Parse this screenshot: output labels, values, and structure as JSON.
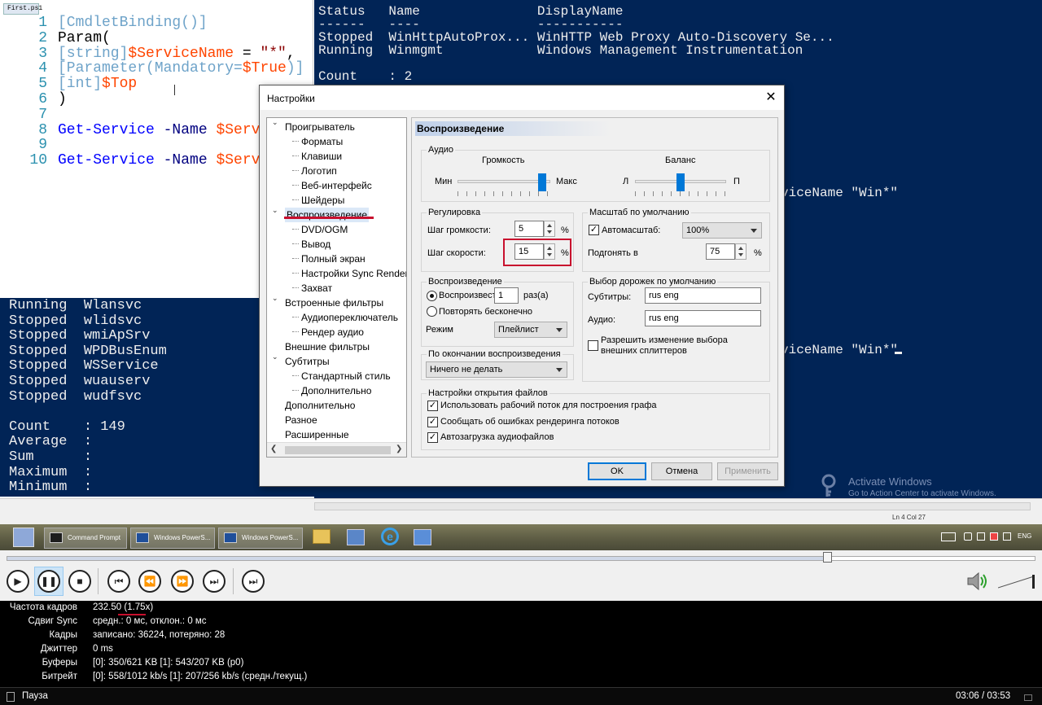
{
  "ise": {
    "tab": "First.ps1",
    "lines": [
      {
        "n": "1",
        "parts": [
          {
            "t": "[CmdletBinding()]",
            "c": "c-br"
          }
        ]
      },
      {
        "n": "2",
        "parts": [
          {
            "t": "Param(",
            "c": "c-plain"
          }
        ]
      },
      {
        "n": "3",
        "parts": [
          {
            "t": "[string]",
            "c": "c-br"
          },
          {
            "t": "$ServiceName",
            "c": "c-var"
          },
          {
            "t": " = ",
            "c": "c-plain"
          },
          {
            "t": "\"*\"",
            "c": "c-str"
          },
          {
            "t": ",",
            "c": "c-plain"
          }
        ]
      },
      {
        "n": "4",
        "parts": [
          {
            "t": "[Parameter(Mandatory=",
            "c": "c-br"
          },
          {
            "t": "$True",
            "c": "c-var"
          },
          {
            "t": ")]",
            "c": "c-br"
          }
        ]
      },
      {
        "n": "5",
        "parts": [
          {
            "t": "[int]",
            "c": "c-br"
          },
          {
            "t": "$Top",
            "c": "c-var"
          }
        ]
      },
      {
        "n": "6",
        "parts": [
          {
            "t": ")",
            "c": "c-plain"
          }
        ]
      },
      {
        "n": "7",
        "parts": []
      },
      {
        "n": "8",
        "parts": [
          {
            "t": "Get-Service",
            "c": "c-cmd"
          },
          {
            "t": " -Name ",
            "c": "c-par"
          },
          {
            "t": "$Serv",
            "c": "c-var"
          }
        ]
      },
      {
        "n": "9",
        "parts": []
      },
      {
        "n": "10",
        "parts": [
          {
            "t": "Get-Service",
            "c": "c-cmd"
          },
          {
            "t": " -Name ",
            "c": "c-par"
          },
          {
            "t": "$Serv",
            "c": "c-var"
          }
        ]
      }
    ]
  },
  "console_top": {
    "lines": [
      "Status   Name               DisplayName",
      "------   ----               -----------",
      "Stopped  WinHttpAutoProx... WinHTTP Web Proxy Auto-Discovery Se...",
      "Running  Winmgmt            Windows Management Instrumentation",
      "",
      "Count    : 2"
    ],
    "frag1": "viceName \"Win*\"",
    "frag2": "viceName \"Win*\""
  },
  "console_bottom": {
    "lines": [
      "Running  Wlansvc",
      "Stopped  wlidsvc",
      "Stopped  wmiApSrv",
      "Stopped  WPDBusEnum",
      "Stopped  WSService",
      "Stopped  wuauserv",
      "Stopped  wudfsvc",
      "",
      "Count    : 149",
      "Average  :",
      "Sum      :",
      "Maximum  :",
      "Minimum  :"
    ]
  },
  "ise_status": {
    "lncol": "Ln 4  Col 27"
  },
  "taskbar": {
    "items": [
      "Command Prompt",
      "Windows PowerS...",
      "Windows PowerS..."
    ],
    "lang": "ENG"
  },
  "activate": {
    "title": "Activate Windows",
    "sub": "Go to Action Center to activate Windows."
  },
  "dialog": {
    "title": "Настройки",
    "close": "✕",
    "tree": [
      {
        "label": "Проигрыватель",
        "level": 0,
        "toggle": "⌄"
      },
      {
        "label": "Форматы",
        "level": 1
      },
      {
        "label": "Клавиши",
        "level": 1
      },
      {
        "label": "Логотип",
        "level": 1
      },
      {
        "label": "Веб-интерфейс",
        "level": 1
      },
      {
        "label": "Шейдеры",
        "level": 1
      },
      {
        "label": "Воспроизведение",
        "level": 0,
        "toggle": "⌄",
        "selected": true
      },
      {
        "label": "DVD/OGM",
        "level": 1
      },
      {
        "label": "Вывод",
        "level": 1
      },
      {
        "label": "Полный экран",
        "level": 1
      },
      {
        "label": "Настройки Sync Render",
        "level": 1
      },
      {
        "label": "Захват",
        "level": 1
      },
      {
        "label": "Встроенные фильтры",
        "level": 0,
        "toggle": "⌄"
      },
      {
        "label": "Аудиопереключатель",
        "level": 1
      },
      {
        "label": "Рендер аудио",
        "level": 1
      },
      {
        "label": "Внешние фильтры",
        "level": 0
      },
      {
        "label": "Субтитры",
        "level": 0,
        "toggle": "⌄"
      },
      {
        "label": "Стандартный стиль",
        "level": 1
      },
      {
        "label": "Дополнительно",
        "level": 1
      },
      {
        "label": "Дополнительно",
        "level": 0
      },
      {
        "label": "Разное",
        "level": 0
      },
      {
        "label": "Расширенные",
        "level": 0
      }
    ],
    "panel": {
      "heading": "Воспроизведение",
      "audio": {
        "legend": "Аудио",
        "volume_label": "Громкость",
        "vol_min": "Мин",
        "vol_max": "Макс",
        "volume_level": 0.95,
        "balance_label": "Баланс",
        "bal_left": "Л",
        "bal_right": "П",
        "balance_level": 0.5
      },
      "regulation": {
        "legend": "Регулировка",
        "vol_step_label": "Шаг громкости:",
        "vol_step": "5",
        "pct1": "%",
        "speed_step_label": "Шаг скорости:",
        "speed_step": "15",
        "pct2": "%"
      },
      "scale": {
        "legend": "Масштаб по умолчанию",
        "autoscale_label": "Автомасштаб:",
        "autoscale_checked": "✓",
        "autoscale_value": "100%",
        "fit_label": "Подгонять в",
        "fit_value": "75",
        "pct": "%"
      },
      "playback": {
        "legend": "Воспроизведение",
        "play_label": "Воспроизвест",
        "play_count": "1",
        "times": "раз(а)",
        "repeat_label": "Повторять бесконечно",
        "mode_label": "Режим",
        "mode_value": "Плейлист"
      },
      "tracks": {
        "legend": "Выбор дорожек по умолчанию",
        "subs_label": "Субтитры:",
        "subs_value": "rus eng",
        "audio_label": "Аудио:",
        "audio_value": "rus eng",
        "splitter_label_1": "Разрешить изменение выбора",
        "splitter_label_2": "внешних сплиттеров"
      },
      "after": {
        "legend": "По окончании воспроизведения",
        "value": "Ничего не делать"
      },
      "files": {
        "legend": "Настройки открытия файлов",
        "opt1": "Использовать рабочий поток для построения графа",
        "opt2": "Сообщать об ошибках рендеринга потоков",
        "opt3": "Автозагрузка аудиофайлов",
        "check": "✓"
      }
    },
    "buttons": {
      "ok": "OK",
      "cancel": "Отмена",
      "apply": "Применить"
    }
  },
  "player": {
    "progress": 0.8,
    "buttons": [
      "play",
      "pause",
      "stop",
      "prev",
      "rewind",
      "forward",
      "next",
      "frame-step"
    ]
  },
  "stats": [
    {
      "k": "Частота кадров",
      "v": "232.50 (1.75x)"
    },
    {
      "k": "Сдвиг Sync",
      "v": "средн.: 0 мс, отклон.: 0 мс"
    },
    {
      "k": "Кадры",
      "v": "записано: 36224, потеряно: 28"
    },
    {
      "k": "Джиттер",
      "v": "0 ms"
    },
    {
      "k": "Буферы",
      "v": "[0]: 350/621 KB [1]: 543/207 KB (p0)"
    },
    {
      "k": "Битрейт",
      "v": "[0]: 558/1012 kb/s [1]: 207/256 kb/s (средн./текущ.)"
    }
  ],
  "status": {
    "state": "Пауза",
    "time": "03:06 / 03:53"
  }
}
